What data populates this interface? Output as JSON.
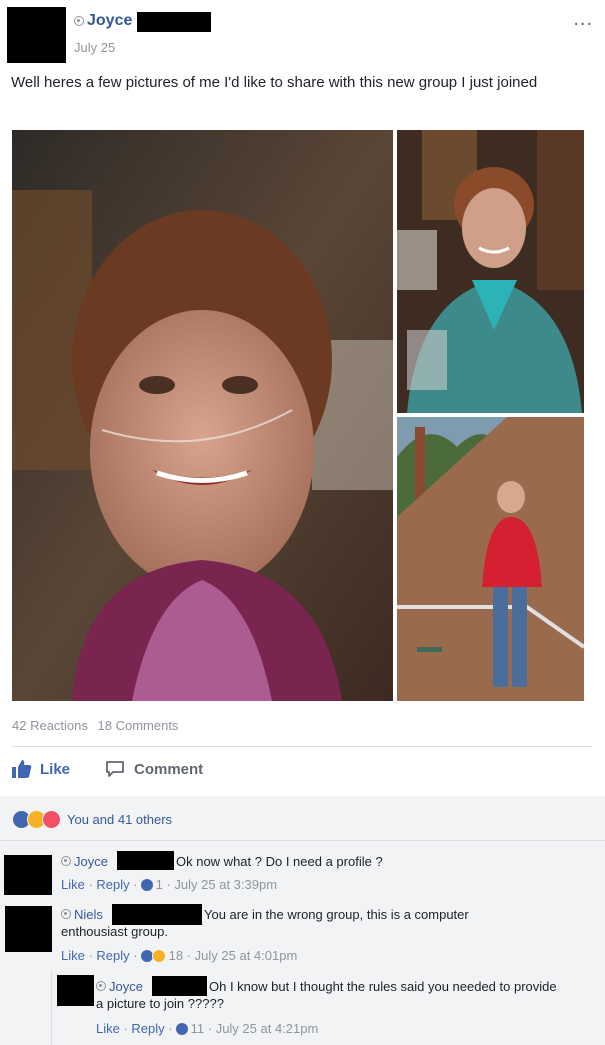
{
  "post": {
    "author": "Joyce",
    "date": "July 25",
    "more_label": "...",
    "text": "Well heres a few pictures of me I'd like to share with this new group I just joined"
  },
  "stats": {
    "reactions": "42 Reactions",
    "comments": "18 Comments"
  },
  "actions": {
    "like": "Like",
    "comment": "Comment"
  },
  "reactions_summary": {
    "text": "You and 41 others",
    "icons": [
      "like-icon",
      "haha-icon",
      "love-icon"
    ],
    "colors": {
      "like": "#4267b2",
      "haha": "#f7b125",
      "love": "#f25268"
    }
  },
  "comments": [
    {
      "name": "Joyce",
      "text": "Ok now what ? Do I need a profile ?",
      "like": "Like",
      "reply": "Reply",
      "count": "1",
      "time": "July 25 at 3:39pm"
    },
    {
      "name": "Niels",
      "text": "You are in the wrong group, this is a computer enthousiast group.",
      "like": "Like",
      "reply": "Reply",
      "count": "18",
      "time": "July 25 at 4:01pm"
    },
    {
      "name": "Joyce",
      "text": "Oh I know but I thought the rules said you needed to provide a picture to join ?????",
      "like": "Like",
      "reply": "Reply",
      "count": "11",
      "time": "July 25 at 4:21pm"
    }
  ]
}
